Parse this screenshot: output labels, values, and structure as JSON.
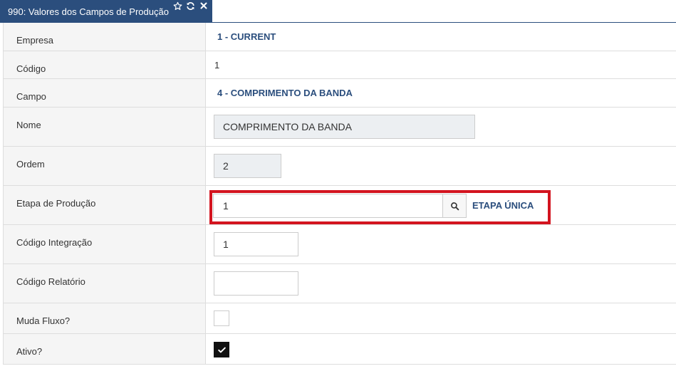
{
  "tab": {
    "title": "990: Valores dos Campos de Produção",
    "favorite_icon": "star-outline-icon",
    "refresh_icon": "refresh-icon",
    "close_icon": "close-icon"
  },
  "form": {
    "empresa": {
      "label": "Empresa",
      "value": "1 - CURRENT"
    },
    "codigo": {
      "label": "Código",
      "value": "1"
    },
    "campo": {
      "label": "Campo",
      "value": "4 - COMPRIMENTO DA BANDA"
    },
    "nome": {
      "label": "Nome",
      "value": "COMPRIMENTO DA BANDA"
    },
    "ordem": {
      "label": "Ordem",
      "value": "2"
    },
    "etapa": {
      "label": "Etapa de Produção",
      "value": "1",
      "description": "ETAPA ÚNICA",
      "search_icon": "search-icon"
    },
    "codigo_integracao": {
      "label": "Código Integração",
      "value": "1"
    },
    "codigo_relatorio": {
      "label": "Código Relatório",
      "value": ""
    },
    "muda_fluxo": {
      "label": "Muda Fluxo?",
      "checked": false
    },
    "ativo": {
      "label": "Ativo?",
      "checked": true
    }
  },
  "colors": {
    "header_blue": "#2b4e7d",
    "highlight_red": "#d3141f",
    "label_bg": "#f5f5f5",
    "readonly_bg": "#eceff2"
  }
}
